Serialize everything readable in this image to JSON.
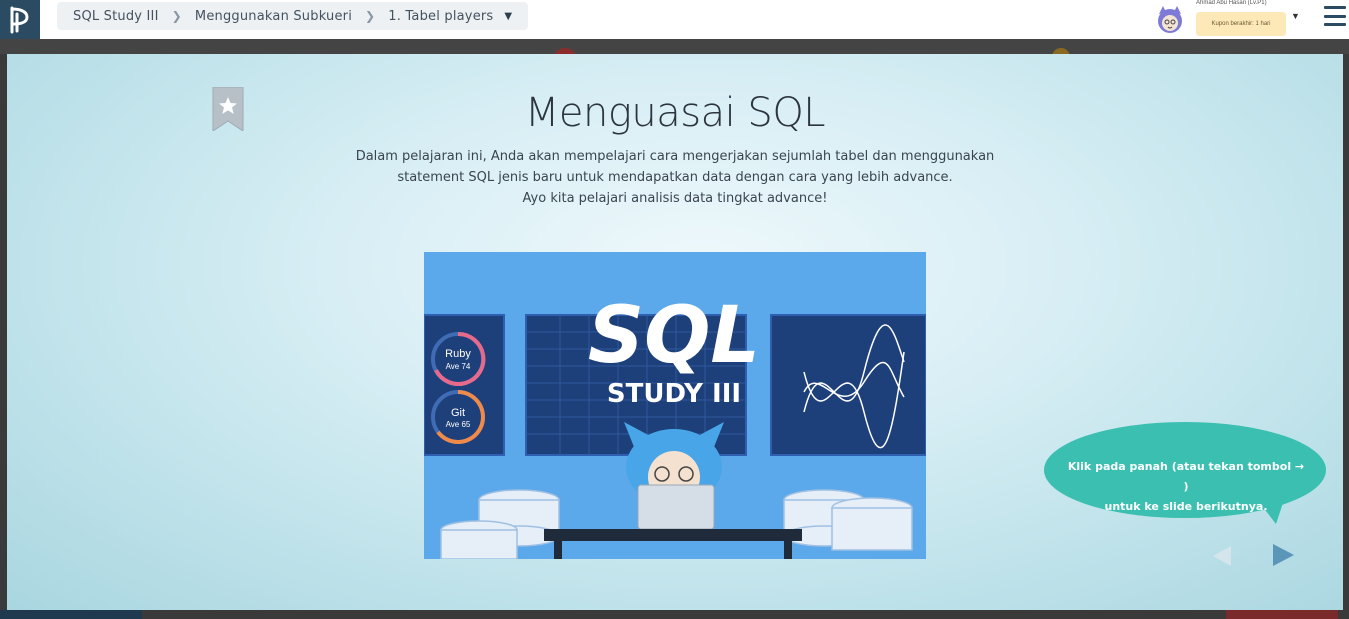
{
  "breadcrumb": {
    "course": "SQL Study III",
    "chapter": "Menggunakan Subkueri",
    "lesson": "1. Tabel players"
  },
  "user": {
    "name": "Ahmad Abu Hasan (Lv.P1)",
    "coupon": "Kupon berakhir: 1 hari"
  },
  "slide": {
    "title": "Menguasai SQL",
    "desc_line1": "Dalam pelajaran ini, Anda akan mempelajari cara mengerjakan sejumlah tabel dan menggunakan",
    "desc_line2": "statement SQL jenis baru untuk mendapatkan data dengan cara yang lebih advance.",
    "desc_line3": "Ayo kita pelajari analisis data tingkat advance!"
  },
  "hero": {
    "logo_text": "SQL",
    "subtitle": "STUDY III",
    "gauge1_label": "Ruby",
    "gauge1_value": "Ave 74",
    "gauge2_label": "Git",
    "gauge2_value": "Ave 65"
  },
  "hint": {
    "line1": "Klik pada panah (atau tekan tombol → )",
    "line2": "untuk ke slide berikutnya."
  },
  "colors": {
    "teal": "#3bbfb0",
    "navy": "#2b4b63",
    "hero_blue": "#5aa6e8",
    "next_arrow": "#5b95b8"
  },
  "icons": [
    "logo-icon",
    "chevron-right-icon",
    "caret-down-icon",
    "avatar-icon",
    "menu-icon",
    "bookmark-star-icon",
    "prev-arrow-icon",
    "next-arrow-icon"
  ]
}
